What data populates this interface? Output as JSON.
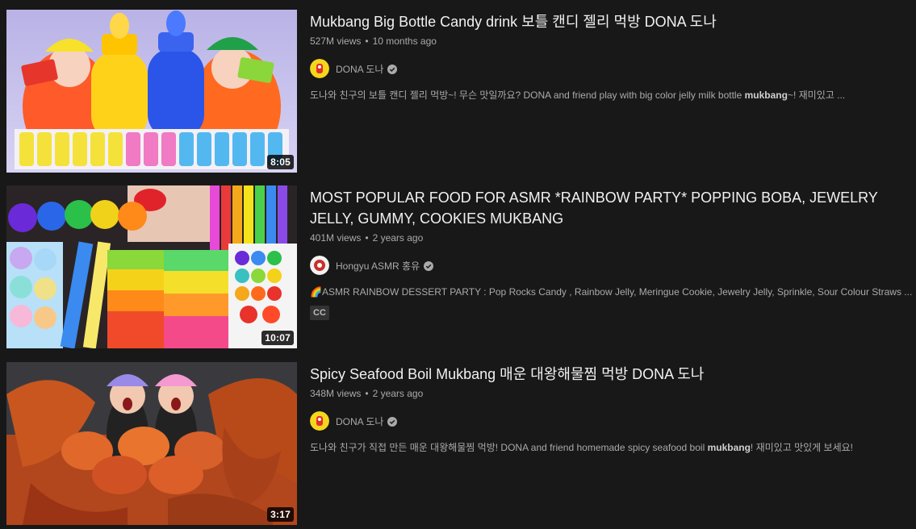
{
  "results": [
    {
      "title": "Mukbang Big Bottle Candy drink 보틀 캔디 젤리 먹방 DONA 도나",
      "views": "527M views",
      "age": "10 months ago",
      "channel": "DONA 도나",
      "description_pre": "도나와 친구의 보틀 캔디 젤리 먹방~! 무슨 맛일까요? DONA and friend play with big color jelly milk bottle ",
      "description_bold": "mukbang",
      "description_post": "~! 재미있고 ...",
      "duration": "8:05"
    },
    {
      "title": "MOST POPULAR FOOD FOR ASMR *RAINBOW PARTY* POPPING BOBA, JEWELRY JELLY, GUMMY, COOKIES MUKBANG",
      "views": "401M views",
      "age": "2 years ago",
      "channel": "Hongyu ASMR 홍유",
      "description_pre": "🌈ASMR RAINBOW DESSERT PARTY : Pop Rocks Candy , Rainbow Jelly, Meringue Cookie, Jewelry Jelly, Sprinkle, Sour Colour Straws ...",
      "description_bold": "",
      "description_post": "",
      "badge": "CC",
      "duration": "10:07"
    },
    {
      "title": "Spicy Seafood Boil Mukbang 매운 대왕해물찜 먹방 DONA 도나",
      "views": "348M views",
      "age": "2 years ago",
      "channel": "DONA 도나",
      "description_pre": "도나와 친구가 직접 만든 매운 대왕해물찜 먹방! DONA and friend homemade spicy seafood boil ",
      "description_bold": "mukbang",
      "description_post": "! 재미있고 맛있게 보세요!",
      "duration": "3:17"
    }
  ],
  "icons": {
    "verified": "verified-check-icon"
  }
}
